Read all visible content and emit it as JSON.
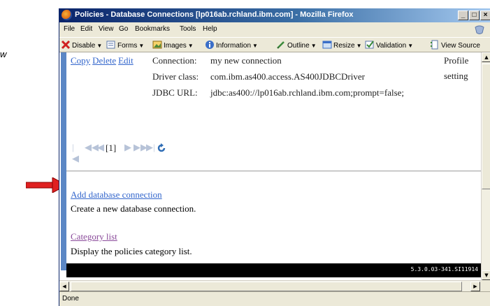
{
  "annotation": {
    "stray_text": "w"
  },
  "window": {
    "title": "Policies - Database Connections [lp016ab.rchland.ibm.com] - Mozilla Firefox",
    "buttons": {
      "minimize": "_",
      "maximize": "□",
      "close": "×"
    }
  },
  "menu": [
    "File",
    "Edit",
    "View",
    "Go",
    "Bookmarks",
    "Tools",
    "Help"
  ],
  "toolbar": [
    "Disable",
    "Forms",
    "Images",
    "Information",
    "Outline",
    "Resize",
    "Validation",
    "View Source"
  ],
  "connection": {
    "actions": {
      "copy": "Copy",
      "delete": "Delete",
      "edit": "Edit"
    },
    "fields": [
      {
        "label": "Connection:",
        "value": "my new connection"
      },
      {
        "label": "Driver class:",
        "value": "com.ibm.as400.access.AS400JDBCDriver"
      },
      {
        "label": "JDBC URL:",
        "value": "jdbc:as400://lp016ab.rchland.ibm.com;prompt=false;"
      }
    ],
    "profile_setting": [
      "Profile",
      "setting"
    ]
  },
  "pager": {
    "current": "[1]"
  },
  "actions": [
    {
      "link": "Add database connection",
      "description": "Create a new database connection.",
      "color": "#3366cc"
    },
    {
      "link": "Category list",
      "description": "Display the policies category list.",
      "color": "#8a4a9a"
    }
  ],
  "footer": {
    "version": "5.3.0.03-341.SI11914"
  },
  "status": "Done",
  "colors": {
    "accent_bar": "#5b87c5",
    "arrow": "#e02020",
    "footer_bg": "#000000"
  }
}
